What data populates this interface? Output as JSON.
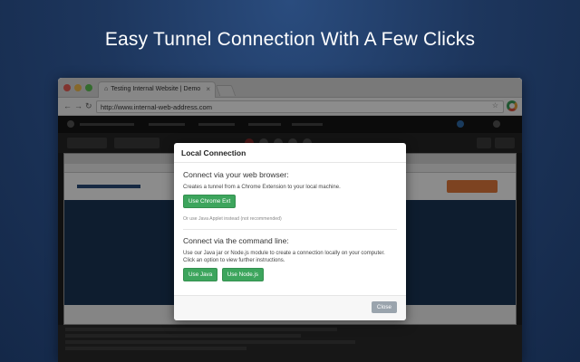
{
  "headline": "Easy Tunnel Connection With A Few Clicks",
  "browser": {
    "tab_title": "Testing Internal Website | Demo",
    "url": "http://www.internal-web-address.com"
  },
  "modal": {
    "title": "Local Connection",
    "browser_section": {
      "title": "Connect via your web browser:",
      "description": "Creates a tunnel from a Chrome Extension to your local machine.",
      "button": "Use Chrome Ext",
      "alt_text": "Or use Java Applet instead (not recommended)"
    },
    "cli_section": {
      "title": "Connect via the command line:",
      "description": "Use our Java jar or Node.js module to create a connection locally on your computer. Click an option to view further instructions.",
      "java_button": "Use Java",
      "node_button": "Use Node.js"
    },
    "close_button": "Close"
  },
  "colors": {
    "primary_green": "#3da55d",
    "background_blue": "#1d365d",
    "close_gray": "#9aa4ad"
  }
}
